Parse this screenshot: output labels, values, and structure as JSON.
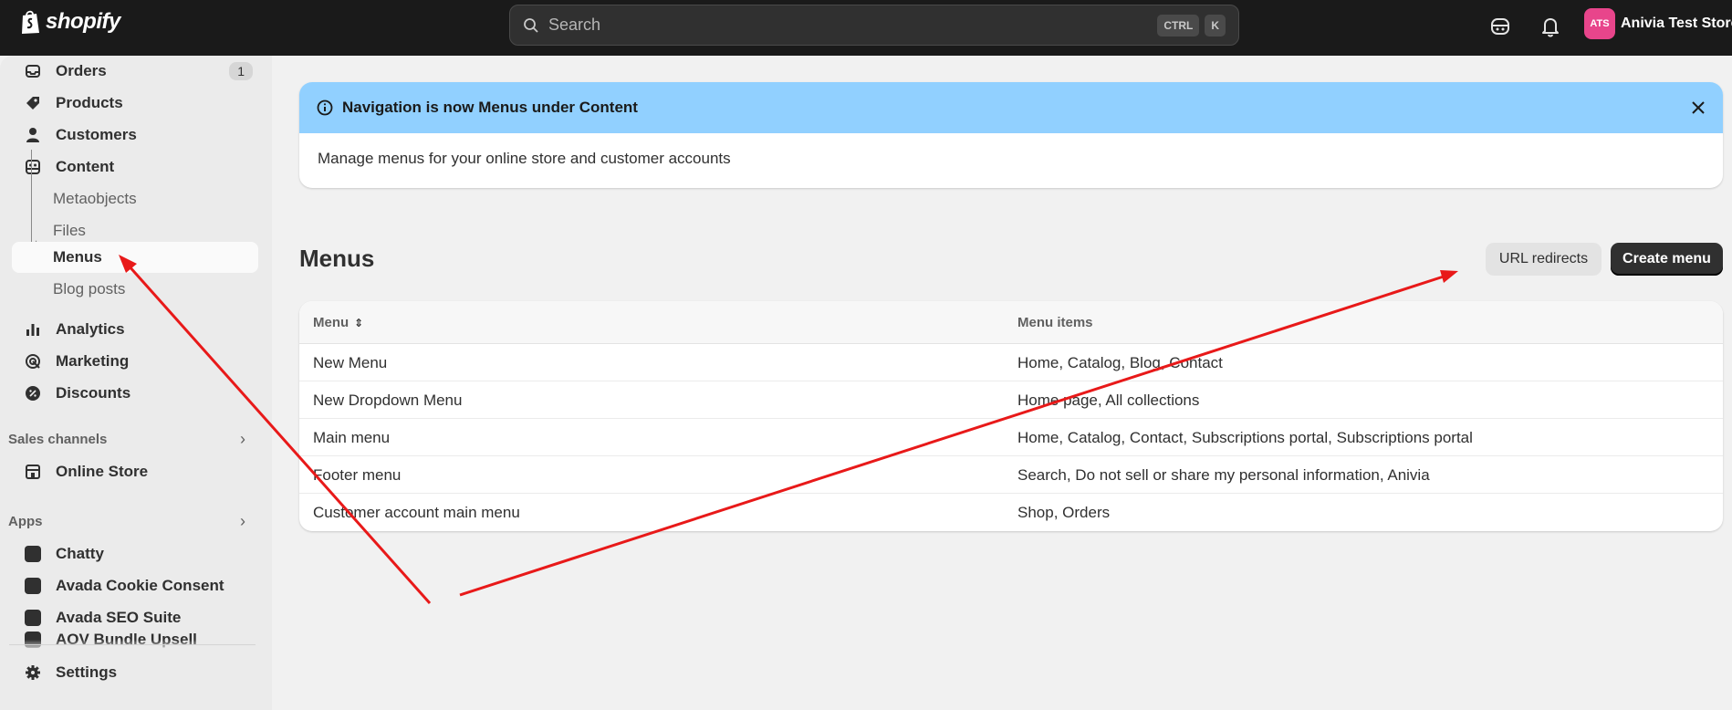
{
  "topbar": {
    "logo_text": "shopify",
    "search_placeholder": "Search",
    "shortcut_keys": [
      "CTRL",
      "K"
    ],
    "store_initials": "ATS",
    "store_name": "Anivia Test Store"
  },
  "sidebar": {
    "items": [
      {
        "label": "Orders",
        "icon": "orders-icon",
        "badge": "1"
      },
      {
        "label": "Products",
        "icon": "tag-icon"
      },
      {
        "label": "Customers",
        "icon": "person-icon"
      },
      {
        "label": "Content",
        "icon": "content-icon"
      },
      {
        "label": "Metaobjects"
      },
      {
        "label": "Files"
      },
      {
        "label": "Menus",
        "active": true
      },
      {
        "label": "Blog posts"
      },
      {
        "label": "Analytics",
        "icon": "bar-chart-icon"
      },
      {
        "label": "Marketing",
        "icon": "target-icon"
      },
      {
        "label": "Discounts",
        "icon": "discount-icon"
      }
    ],
    "sales_channels": {
      "heading": "Sales channels",
      "items": [
        {
          "label": "Online Store",
          "icon": "store-icon"
        }
      ]
    },
    "apps": {
      "heading": "Apps",
      "items": [
        {
          "label": "Chatty"
        },
        {
          "label": "Avada Cookie Consent"
        },
        {
          "label": "Avada SEO Suite"
        },
        {
          "label": "AOV Bundle Upsell"
        }
      ]
    },
    "settings_label": "Settings"
  },
  "banner": {
    "title": "Navigation is now Menus under Content",
    "body": "Manage menus for your online store and customer accounts"
  },
  "page": {
    "title": "Menus",
    "secondary_button": "URL redirects",
    "primary_button": "Create menu"
  },
  "table": {
    "headers": [
      "Menu",
      "Menu items"
    ],
    "rows": [
      [
        "New Menu",
        "Home, Catalog, Blog, Contact"
      ],
      [
        "New Dropdown Menu",
        "Home page, All collections"
      ],
      [
        "Main menu",
        "Home, Catalog, Contact, Subscriptions portal, Subscriptions portal"
      ],
      [
        "Footer menu",
        "Search, Do not sell or share my personal information, Anivia"
      ],
      [
        "Customer account main menu",
        "Shop, Orders"
      ]
    ]
  },
  "colors": {
    "topbar": "#1a1a1a",
    "banner_header": "#91d0ff",
    "primary_button": "#303030",
    "annotation_arrows": "#e81919",
    "store_avatar": "#e8458b"
  }
}
